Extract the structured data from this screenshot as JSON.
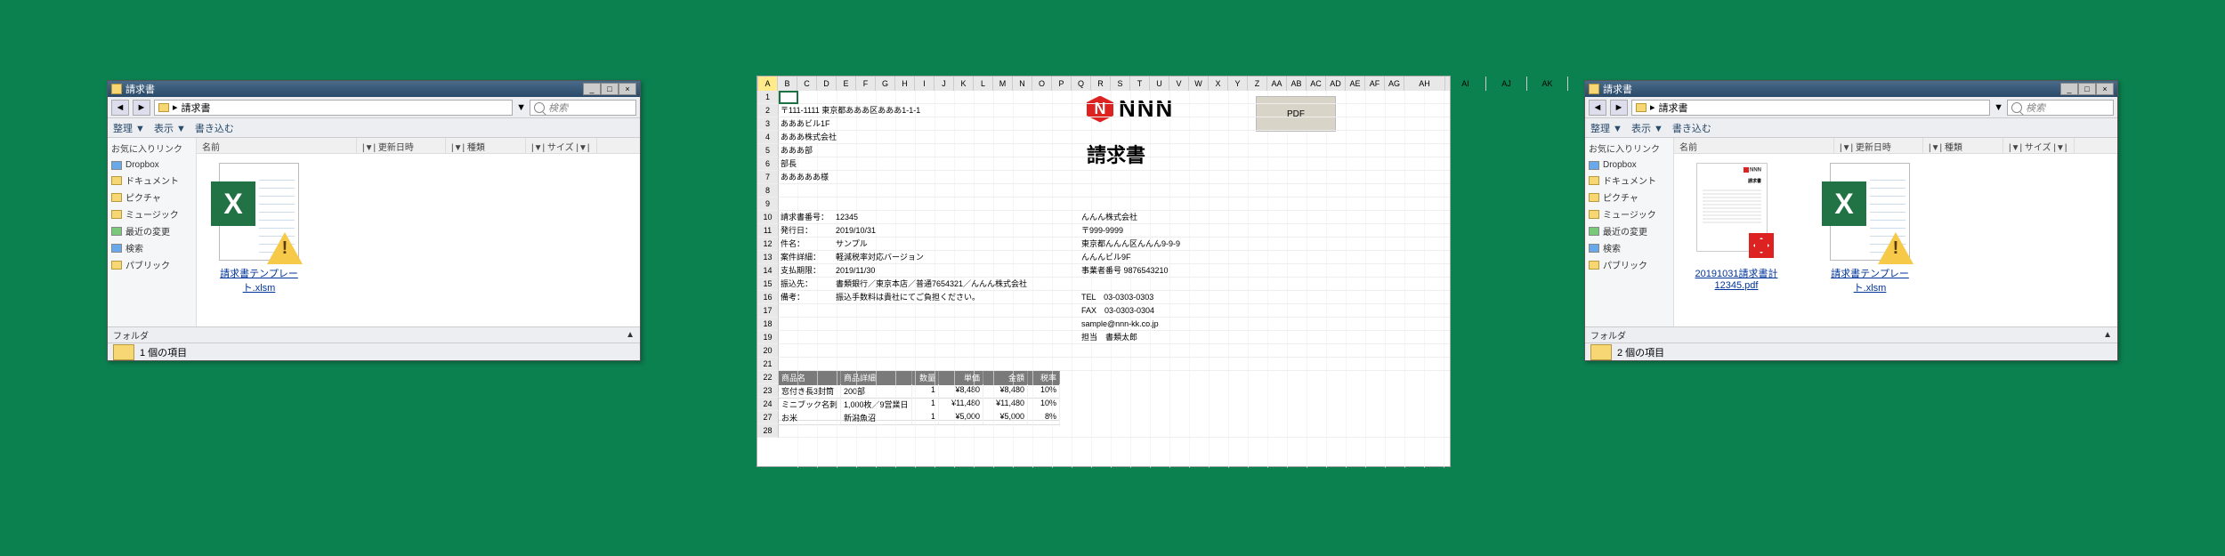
{
  "window_title": "請求書",
  "address_bar": "請求書",
  "search_placeholder": "検索",
  "toolbar": {
    "organize": "整理 ▼",
    "view": "表示 ▼",
    "burn": "書き込む"
  },
  "sidebar": {
    "header": "お気に入りリンク",
    "items": [
      "Dropbox",
      "ドキュメント",
      "ピクチャ",
      "ミュージック",
      "最近の変更",
      "検索",
      "パブリック"
    ]
  },
  "folder_footer": "フォルダ",
  "columns": {
    "name": "名前",
    "date": "更新日時",
    "type": "種類",
    "size": "サイズ"
  },
  "files": {
    "template": "請求書テンプレート.xlsm",
    "pdf": "20191031請求書計12345.pdf"
  },
  "status": {
    "left": "1 個の項目",
    "right": "2 個の項目"
  },
  "excel": {
    "cols": [
      "A",
      "B",
      "C",
      "D",
      "E",
      "F",
      "G",
      "H",
      "I",
      "J",
      "K",
      "L",
      "M",
      "N",
      "O",
      "P",
      "Q",
      "R",
      "S",
      "T",
      "U",
      "V",
      "W",
      "X",
      "Y",
      "Z",
      "AA",
      "AB",
      "AC",
      "AD",
      "AE",
      "AF",
      "AG"
    ],
    "wide_cols": [
      "AH",
      "AI",
      "AJ",
      "AK"
    ],
    "logo_text": "NNN",
    "logo_n": "N",
    "invoice_title": "請求書",
    "pdf_button": "PDF",
    "rows": {
      "addr1": "〒111-1111 東京都あああ区あああ1-1-1",
      "addr2": "あああビル1F",
      "company": "あああ株式会社",
      "dept": "あああ部",
      "section": "部長",
      "name": "あああああ様"
    },
    "fields": [
      {
        "label": "請求書番号：",
        "value": "12345"
      },
      {
        "label": "発行日：",
        "value": "2019/10/31"
      },
      {
        "label": "件名：",
        "value": "サンプル"
      },
      {
        "label": "案件詳細：",
        "value": "軽減税率対応バージョン"
      },
      {
        "label": "支払期限：",
        "value": "2019/11/30"
      },
      {
        "label": "振込先：",
        "value": "書類銀行／東京本店／普通7654321／んんん株式会社"
      },
      {
        "label": "備考：",
        "value": "振込手数料は貴社にてご負担ください。"
      }
    ],
    "right_info": [
      "んんん株式会社",
      "〒999-9999",
      "東京都んんん区んんん9-9-9",
      "んんんビル9F",
      "事業者番号 9876543210",
      "",
      "TEL　03-0303-0303",
      "FAX　03-0303-0304",
      "sample@nnn-kk.co.jp",
      "担当　書類太郎"
    ],
    "tbl_head": [
      "商品名",
      "商品詳細",
      "数量",
      "単価",
      "金額",
      "税率"
    ],
    "tbl_rows": [
      {
        "name": "窓付き長3封筒",
        "detail": "200部",
        "qty": "1",
        "unit": "¥8,480",
        "amount": "¥8,480",
        "tax": "10%"
      },
      {
        "name": "ミニブック名刺",
        "detail": "1,000枚／9営業日",
        "qty": "1",
        "unit": "¥11,480",
        "amount": "¥11,480",
        "tax": "10%"
      },
      {
        "name": "お米",
        "detail": "新潟魚沼",
        "qty": "1",
        "unit": "¥5,000",
        "amount": "¥5,000",
        "tax": "8%"
      }
    ]
  }
}
